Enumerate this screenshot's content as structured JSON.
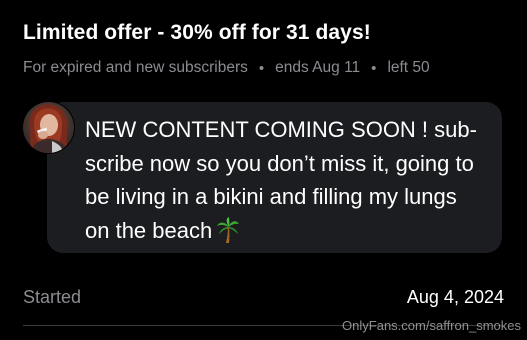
{
  "offer": {
    "title": "Limited offer - 30% off for 31 days!",
    "meta_audience": "For expired and new subscribers",
    "meta_ends": "ends Aug 11",
    "meta_left": "left 50",
    "separator": "•"
  },
  "message": {
    "lines": [
      "NEW CONTENT COMING SOON ! sub-",
      "scribe now so you don’t miss it, going to",
      "be living in a bikini and filling my lungs",
      "on the beach"
    ],
    "emoji_icon": "palm-tree-icon"
  },
  "details": {
    "started_label": "Started",
    "started_value": "Aug 4, 2024"
  },
  "watermark": "OnlyFans.com/saffron_smokes",
  "colors": {
    "background": "#000000",
    "bubble": "#1c1d20",
    "muted_text": "#8a8c90",
    "primary_text": "#ffffff"
  }
}
